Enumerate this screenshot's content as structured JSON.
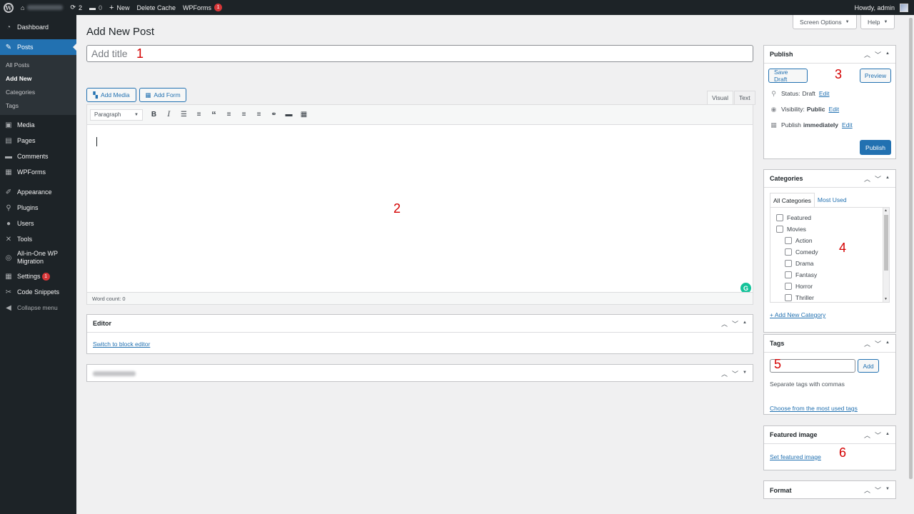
{
  "adminbar": {
    "updates_count": "2",
    "comments_count": "0",
    "new_label": "New",
    "delete_cache_label": "Delete Cache",
    "wpforms_label": "WPForms",
    "wpforms_badge": "1",
    "howdy_label": "Howdy, admin"
  },
  "sidebar": {
    "dashboard": "Dashboard",
    "posts": "Posts",
    "submenu": [
      "All Posts",
      "Add New",
      "Categories",
      "Tags"
    ],
    "media": "Media",
    "pages": "Pages",
    "comments": "Comments",
    "wpforms": "WPForms",
    "appearance": "Appearance",
    "plugins": "Plugins",
    "users": "Users",
    "tools": "Tools",
    "aiowm_line1": "All-in-One WP",
    "aiowm_line2": "Migration",
    "settings": "Settings",
    "settings_badge": "1",
    "code_snippets": "Code Snippets",
    "collapse": "Collapse menu"
  },
  "header": {
    "page_title": "Add New Post",
    "screen_options": "Screen Options",
    "help": "Help"
  },
  "title_field": {
    "placeholder": "Add title"
  },
  "editor": {
    "add_media": "Add Media",
    "add_form": "Add Form",
    "tab_visual": "Visual",
    "tab_text": "Text",
    "format_select": "Paragraph",
    "word_count": "Word count: 0"
  },
  "editor_box": {
    "title": "Editor",
    "switch_link": "Switch to block editor"
  },
  "publish_box": {
    "title": "Publish",
    "save_draft": "Save Draft",
    "preview": "Preview",
    "status_label": "Status:",
    "status_value": "Draft",
    "visibility_label": "Visibility:",
    "visibility_value": "Public",
    "publish_label": "Publish",
    "publish_value": "immediately",
    "edit": "Edit",
    "publish_button": "Publish"
  },
  "categories_box": {
    "title": "Categories",
    "tab_all": "All Categories",
    "tab_most_used": "Most Used",
    "items": [
      "Featured",
      "Movies",
      "Action",
      "Comedy",
      "Drama",
      "Fantasy",
      "Horror",
      "Thriller"
    ],
    "add_new": "+ Add New Category"
  },
  "tags_box": {
    "title": "Tags",
    "add_button": "Add",
    "hint": "Separate tags with commas",
    "choose_link": "Choose from the most used tags"
  },
  "featured_image_box": {
    "title": "Featured image",
    "set_link": "Set featured image"
  },
  "format_box": {
    "title": "Format"
  },
  "annotations": [
    "1",
    "2",
    "3",
    "4",
    "5",
    "6"
  ],
  "colors": {
    "admin_dark": "#1d2327",
    "accent_blue": "#2271b1",
    "annotation_red": "#d40000",
    "badge_red": "#d63638"
  }
}
